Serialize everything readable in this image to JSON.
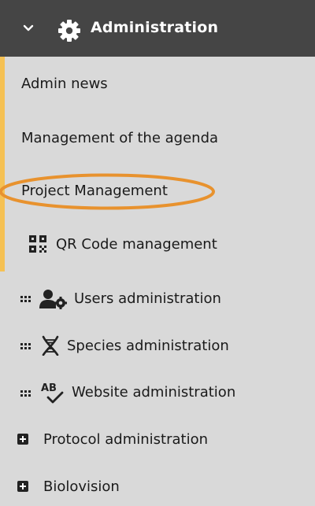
{
  "header": {
    "title": "Administration",
    "chevron_icon": "chevron-down-icon",
    "icon": "gear-icon",
    "background": "#454545"
  },
  "accent_color": "#f5c154",
  "highlight_color": "#e8922e",
  "items": [
    {
      "label": "Admin news"
    },
    {
      "label": "Management of the agenda"
    },
    {
      "label": "Project Management",
      "highlighted": true
    },
    {
      "label": "QR Code management",
      "icon": "qr-code-icon"
    },
    {
      "label": "Users administration",
      "icon": "user-gear-icon",
      "handle": "drag-handle-icon"
    },
    {
      "label": "Species administration",
      "icon": "dna-icon",
      "handle": "drag-handle-icon"
    },
    {
      "label": "Website administration",
      "icon": "spellcheck-icon",
      "handle": "drag-handle-icon"
    },
    {
      "label": "Protocol administration",
      "icon": "plus-square-icon"
    },
    {
      "label": "Biolovision",
      "icon": "plus-square-icon"
    }
  ]
}
